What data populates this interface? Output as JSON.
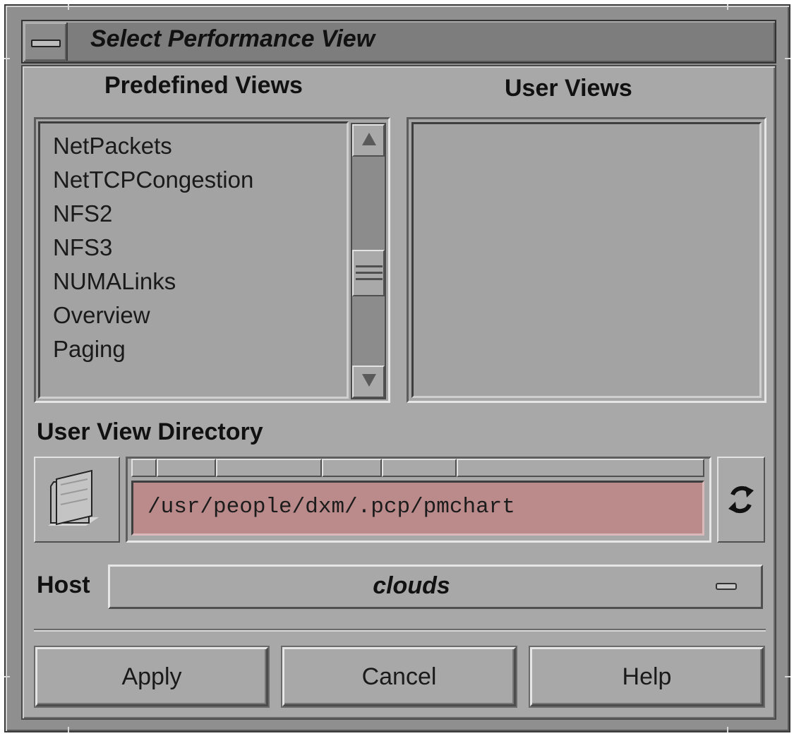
{
  "window": {
    "title": "Select Performance View"
  },
  "predefined": {
    "heading": "Predefined Views",
    "items": [
      "NetPackets",
      "NetTCPCongestion",
      "NFS2",
      "NFS3",
      "NUMALinks",
      "Overview",
      "Paging"
    ]
  },
  "user_views": {
    "heading": "User Views",
    "items": []
  },
  "directory": {
    "label": "User View Directory",
    "path": "/usr/people/dxm/.pcp/pmchart",
    "folder_icon": "folder-icon",
    "refresh_icon": "refresh-icon"
  },
  "host": {
    "label": "Host",
    "value": "clouds"
  },
  "buttons": {
    "apply": "Apply",
    "cancel": "Cancel",
    "help": "Help"
  },
  "colors": {
    "path_field_bg": "#bb8a8a",
    "window_bg": "#a8a8a8"
  }
}
